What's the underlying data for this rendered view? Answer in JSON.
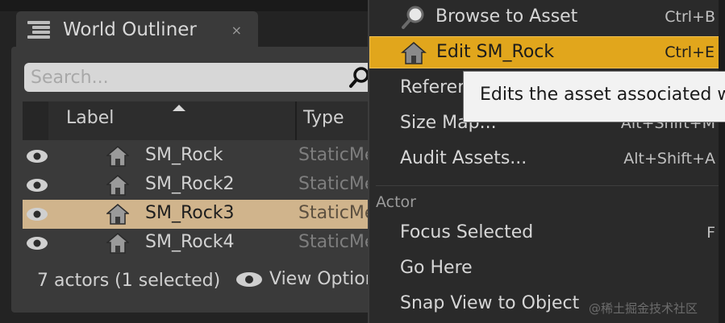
{
  "outliner": {
    "tab_title": "World Outliner",
    "close_glyph": "×",
    "search_placeholder": "Search...",
    "columns": {
      "label": "Label",
      "type": "Type"
    },
    "rows": [
      {
        "name": "SM_Rock",
        "type": "StaticMesh",
        "selected": false
      },
      {
        "name": "SM_Rock2",
        "type": "StaticMesh",
        "selected": false
      },
      {
        "name": "SM_Rock3",
        "type": "StaticMesh",
        "selected": true
      },
      {
        "name": "SM_Rock4",
        "type": "StaticMesh",
        "selected": false
      }
    ],
    "footer_status": "7 actors (1 selected)",
    "view_options_label": "View Options"
  },
  "menu": {
    "items": [
      {
        "label": "Browse to Asset",
        "shortcut": "Ctrl+B",
        "icon": "magnifier-icon"
      },
      {
        "label": "Edit SM_Rock",
        "shortcut": "Ctrl+E",
        "icon": "house-icon",
        "highlighted": true
      },
      {
        "label": "Reference Viewer...",
        "shortcut": ""
      },
      {
        "label": "Size Map...",
        "shortcut": "Alt+Shift+M"
      },
      {
        "label": "Audit Assets...",
        "shortcut": "Alt+Shift+A"
      }
    ],
    "section_actor": "Actor",
    "actor_items": [
      {
        "label": "Focus Selected",
        "shortcut": "F"
      },
      {
        "label": "Go Here",
        "shortcut": ""
      },
      {
        "label": "Snap View to Object",
        "shortcut": ""
      }
    ]
  },
  "tooltip": {
    "text": "Edits the asset associated with the selected actor"
  },
  "watermark": "@稀土掘金技术社区",
  "colors": {
    "highlight": "#e1a61c",
    "selected_row": "#d0b48c",
    "panel": "#3a3a3a",
    "menu_bg": "#2a2a2a"
  }
}
